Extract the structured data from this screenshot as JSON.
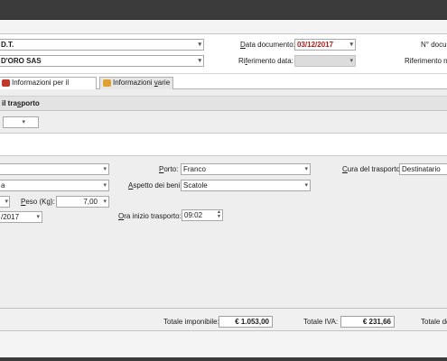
{
  "header": {
    "document_type_value": "D.T.",
    "customer_value": "D'ORO SAS",
    "date_label_prefix": "D",
    "date_label_rest": "ata documento:",
    "date_value": "03/12/2017",
    "reference_date_label_prefix": "Ri",
    "reference_date_label_u": "f",
    "reference_date_label_rest": "erimento data:",
    "reference_date_value": "",
    "doc_number_label": "N° docum",
    "reference_number_label": "Riferimento nu"
  },
  "tabs": [
    {
      "label_pre": "Informazioni per il tra",
      "label_u": "s",
      "label_post": "porto",
      "icon": "truck-icon",
      "color": "#c0392b"
    },
    {
      "label_pre": "Informazioni ",
      "label_u": "v",
      "label_post": "arie",
      "icon": "folder-icon",
      "color": "#e0a030"
    }
  ],
  "section": {
    "title_pre": "il tra",
    "title_u": "s",
    "title_post": "porto"
  },
  "transport": {
    "porto_label_u": "P",
    "porto_label_rest": "orto:",
    "porto_value": "Franco",
    "aspetto_label_pre": "",
    "aspetto_label_u": "A",
    "aspetto_label_rest": "spetto dei beni:",
    "aspetto_value": "Scatole",
    "cura_label_u": "C",
    "cura_label_rest": "ura del trasporto:",
    "cura_value": "Destinatario",
    "select2_value": "a",
    "peso_label_u": "P",
    "peso_label_rest": "eso (Kg):",
    "peso_value": "7,00",
    "ora_label_u": "O",
    "ora_label_rest": "ra inizio trasporto:",
    "ora_value": "09:02",
    "date_fragment": "/2017"
  },
  "totals": {
    "imponibile_label": "Totale imponibile:",
    "imponibile_value": "€ 1.053,00",
    "iva_label": "Totale IVA:",
    "iva_value": "€ 231,66",
    "totale_label": "Totale do"
  }
}
